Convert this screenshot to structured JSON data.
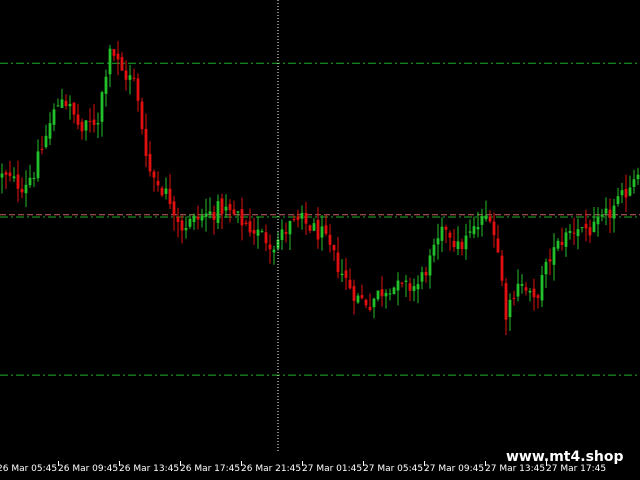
{
  "watermark": "www.mt4.shop",
  "colors": {
    "background": "#000000",
    "bull": "#22c02a",
    "bear": "#e01010",
    "level_line": "#1fae2a",
    "mid_line": "#c86464",
    "crosshair": "#ffffff",
    "axis_text": "#ffffff"
  },
  "chart_data": {
    "type": "candlestick",
    "x_tick_labels": [
      "26 Mar 05:45",
      "26 Mar 09:45",
      "26 Mar 13:45",
      "26 Mar 17:45",
      "26 Mar 21:45",
      "27 Mar 01:45",
      "27 Mar 05:45",
      "27 Mar 09:45",
      "27 Mar 13:45",
      "27 Mar 17:45"
    ],
    "candle_count": 160,
    "y_range": [
      0,
      100
    ],
    "levels": [
      {
        "kind": "dash-dot",
        "value": 86,
        "color": "#1fae2a"
      },
      {
        "kind": "dash-dot",
        "value": 52,
        "color": "#1fae2a"
      },
      {
        "kind": "dashed",
        "value": 52.5,
        "color": "#c86464"
      },
      {
        "kind": "dash-dot",
        "value": 17,
        "color": "#1fae2a"
      }
    ],
    "crosshair_x_index": 69,
    "grid": false,
    "close_path": [
      [
        0,
        61
      ],
      [
        5,
        59
      ],
      [
        8,
        62
      ],
      [
        13,
        75
      ],
      [
        15,
        79
      ],
      [
        20,
        71
      ],
      [
        24,
        74
      ],
      [
        27,
        90
      ],
      [
        30,
        84
      ],
      [
        33,
        82
      ],
      [
        37,
        62
      ],
      [
        42,
        56
      ],
      [
        45,
        50
      ],
      [
        50,
        52
      ],
      [
        55,
        54
      ],
      [
        60,
        51
      ],
      [
        63,
        49
      ],
      [
        68,
        46
      ],
      [
        72,
        50
      ],
      [
        75,
        51
      ],
      [
        80,
        48
      ],
      [
        83,
        43
      ],
      [
        86,
        38
      ],
      [
        89,
        34
      ],
      [
        92,
        33
      ],
      [
        94,
        35
      ],
      [
        97,
        37
      ],
      [
        100,
        36
      ],
      [
        104,
        37
      ],
      [
        108,
        44
      ],
      [
        111,
        50
      ],
      [
        114,
        45
      ],
      [
        118,
        49
      ],
      [
        122,
        53
      ],
      [
        124,
        44
      ],
      [
        126,
        31
      ],
      [
        129,
        38
      ],
      [
        133,
        33
      ],
      [
        137,
        43
      ],
      [
        140,
        47
      ],
      [
        144,
        50
      ],
      [
        148,
        49
      ],
      [
        152,
        53
      ],
      [
        155,
        56
      ],
      [
        159,
        63
      ]
    ]
  }
}
